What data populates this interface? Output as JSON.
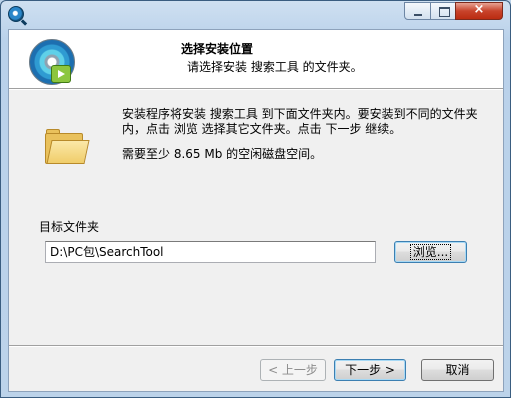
{
  "window": {
    "app_icon": "search-magnifier-icon",
    "controls": {
      "minimize": "minimize-icon",
      "maximize": "maximize-icon",
      "close": "×"
    }
  },
  "header": {
    "title": "选择安装位置",
    "subtitle": "请选择安装 搜索工具 的文件夹。",
    "icon": "setup-disc-icon"
  },
  "body": {
    "icon": "folder-icon",
    "description_line1": "安装程序将安装 搜索工具 到下面文件夹内。要安装到不同的文件夹",
    "description_line2": "内，点击 浏览 选择其它文件夹。点击 下一步 继续。",
    "space_required": "需要至少 8.65 Mb 的空闲磁盘空间。"
  },
  "destination": {
    "label": "目标文件夹",
    "path": "D:\\PC包\\SearchTool",
    "browse_label": "浏览..."
  },
  "buttons": {
    "back": "< 上一步",
    "next": "下一步 >",
    "cancel": "取消"
  }
}
